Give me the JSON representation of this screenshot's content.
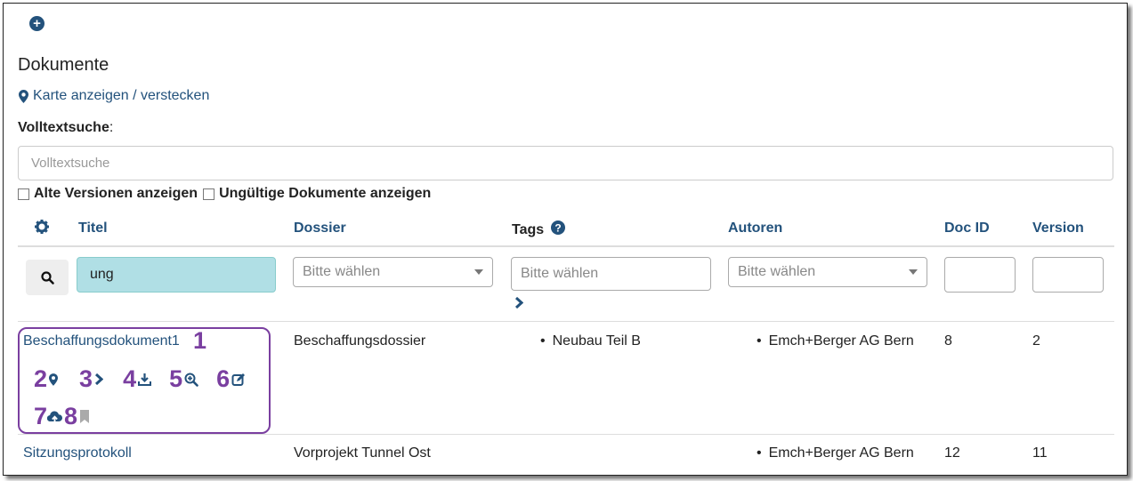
{
  "page": {
    "title": "Dokumente"
  },
  "map_toggle": {
    "label": "Karte anzeigen / verstecken"
  },
  "fulltext": {
    "label": "Volltextsuche",
    "colon": ":",
    "placeholder": "Volltextsuche"
  },
  "options": {
    "old_versions": "Alte Versionen anzeigen",
    "invalid_docs": "Ungültige Dokumente anzeigen"
  },
  "columns": {
    "title": "Titel",
    "dossier": "Dossier",
    "tags": "Tags",
    "authors": "Autoren",
    "docid": "Doc ID",
    "version": "Version"
  },
  "filters": {
    "title_value": "ung",
    "dossier_placeholder": "Bitte wählen",
    "tags_placeholder": "Bitte wählen",
    "authors_placeholder": "Bitte wählen"
  },
  "rows": [
    {
      "title": "Beschaffungsdokument1",
      "dossier": "Beschaffungsdossier",
      "tag": "Neubau Teil B",
      "author": "Emch+Berger AG Bern",
      "docid": "8",
      "version": "2"
    },
    {
      "title": "Sitzungsprotokoll",
      "dossier": "Vorprojekt Tunnel Ost",
      "tag": "",
      "author": "Emch+Berger AG Bern",
      "docid": "12",
      "version": "11"
    }
  ],
  "annotations": [
    "1",
    "2",
    "3",
    "4",
    "5",
    "6",
    "7",
    "8"
  ],
  "colors": {
    "link": "#23527c",
    "annotation": "#7a3fa0",
    "highlight": "#b0dfe5"
  },
  "icons": [
    "plus-circle-icon",
    "map-marker-icon",
    "gear-icon",
    "question-circle-icon",
    "search-icon",
    "chevron-right-icon",
    "download-icon",
    "zoom-in-icon",
    "edit-icon",
    "cloud-upload-icon",
    "bookmark-icon"
  ]
}
